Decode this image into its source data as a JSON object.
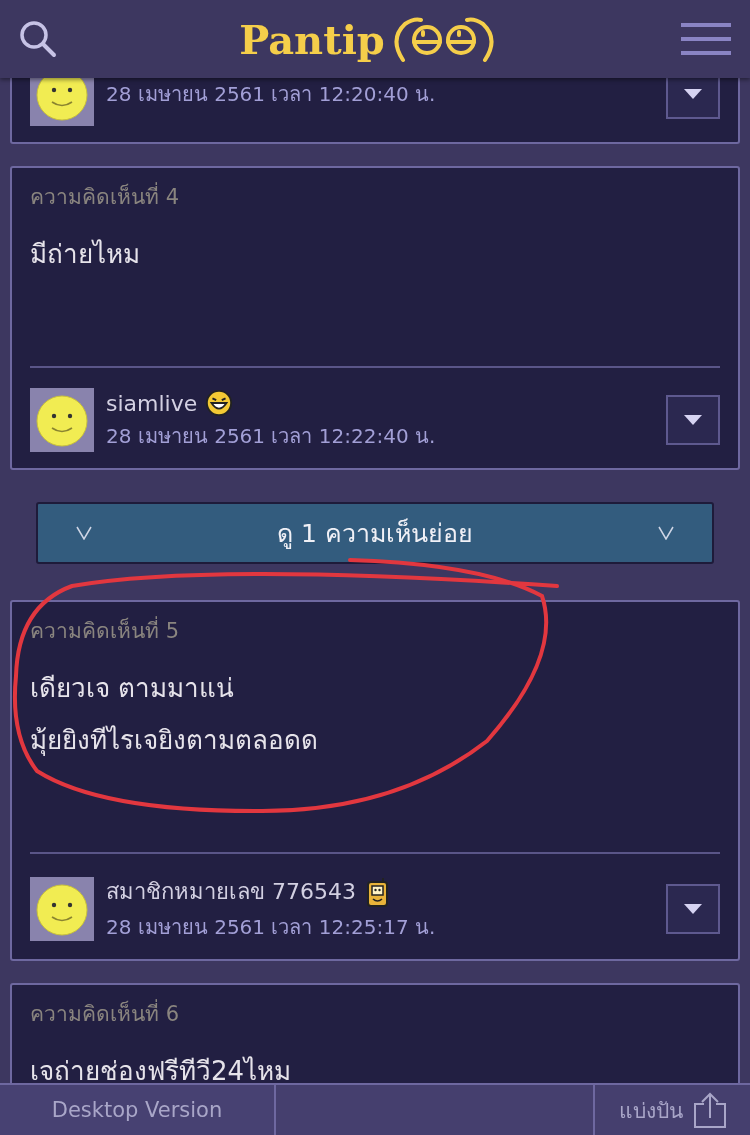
{
  "header": {
    "logo": "Pantip"
  },
  "partial_comment": {
    "date": "28 เมษายน 2561 เวลา 12:20:40 น."
  },
  "items": [
    {
      "kind": "comment",
      "label": "ความคิดเห็นที่ 4",
      "body": [
        "มีถ่ายไหม"
      ],
      "author": "siamlive",
      "badge": {
        "kind": "laugh"
      },
      "date": "28 เมษายน 2561 เวลา 12:22:40 น.",
      "annotated": false
    },
    {
      "kind": "replies",
      "label": "ดู 1 ความเห็นย่อย"
    },
    {
      "kind": "comment",
      "label": "ความคิดเห็นที่ 5",
      "body": [
        "เดียวเจ ตามมาแน่",
        "มุ้ยยิงทีไรเจยิงตามตลอดด"
      ],
      "author": "สมาชิกหมายเลข 776543",
      "badge": {
        "kind": "pager"
      },
      "date": "28 เมษายน 2561 เวลา 12:25:17 น.",
      "annotated": true
    },
    {
      "kind": "comment",
      "label": "ความคิดเห็นที่ 6",
      "body": [
        "เจถ่ายช่องฟรีทีวี24ไหม"
      ],
      "annotated": false
    }
  ],
  "footer": {
    "desktop": "Desktop Version",
    "share": "แบ่งปัน"
  }
}
